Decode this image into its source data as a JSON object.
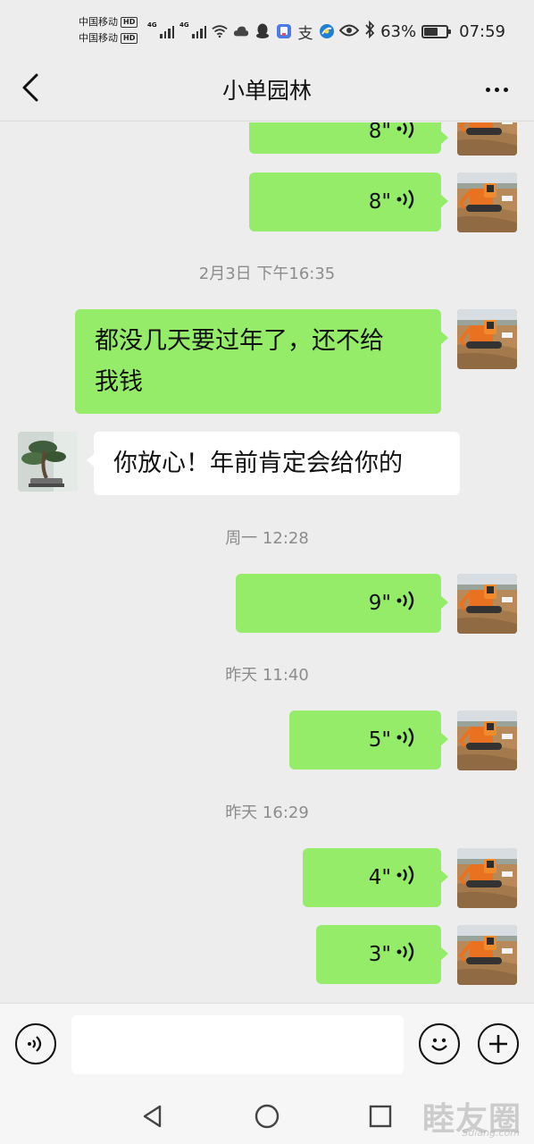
{
  "status_bar": {
    "carrier_1": "中国移动",
    "carrier_2": "中国移动",
    "hd_label": "HD",
    "network_1": "4G",
    "network_2": "4G",
    "battery_percent": "63%",
    "battery_level": 0.63,
    "time": "07:59",
    "icons": [
      "wifi-icon",
      "cloud-icon",
      "qq-icon",
      "app-icon",
      "alipay-icon",
      "browser-icon",
      "eye-icon",
      "bluetooth-icon"
    ]
  },
  "header": {
    "title": "小单园林",
    "back_icon": "chevron-left-icon",
    "more_icon": "more-dots-icon"
  },
  "messages": [
    {
      "type": "voice",
      "sender": "me",
      "duration": "8\""
    },
    {
      "type": "voice",
      "sender": "me",
      "duration": "8\""
    },
    {
      "type": "timestamp",
      "text": "2月3日 下午16:35"
    },
    {
      "type": "text",
      "sender": "me",
      "lines": [
        "都没几天要过年了，还不给",
        "我钱"
      ]
    },
    {
      "type": "text",
      "sender": "other",
      "text": "你放心！年前肯定会给你的"
    },
    {
      "type": "timestamp",
      "text": "周一 12:28"
    },
    {
      "type": "voice",
      "sender": "me",
      "duration": "9\""
    },
    {
      "type": "timestamp",
      "text": "昨天 11:40"
    },
    {
      "type": "voice",
      "sender": "me",
      "duration": "5\""
    },
    {
      "type": "timestamp",
      "text": "昨天 16:29"
    },
    {
      "type": "voice",
      "sender": "me",
      "duration": "4\""
    },
    {
      "type": "voice",
      "sender": "me",
      "duration": "3\""
    }
  ],
  "input_bar": {
    "voice_icon": "voice-input-icon",
    "emoji_icon": "emoji-icon",
    "plus_icon": "plus-icon",
    "input_value": ""
  },
  "nav_bar": {
    "back_icon": "nav-back-icon",
    "home_icon": "nav-home-icon",
    "recents_icon": "nav-recents-icon"
  },
  "colors": {
    "background": "#ededed",
    "my_bubble": "#95ec69",
    "their_bubble": "#ffffff",
    "timestamp_text": "#8c8c8c"
  },
  "watermark": {
    "text": "睦友圈",
    "sub": "Sdiang.com"
  }
}
